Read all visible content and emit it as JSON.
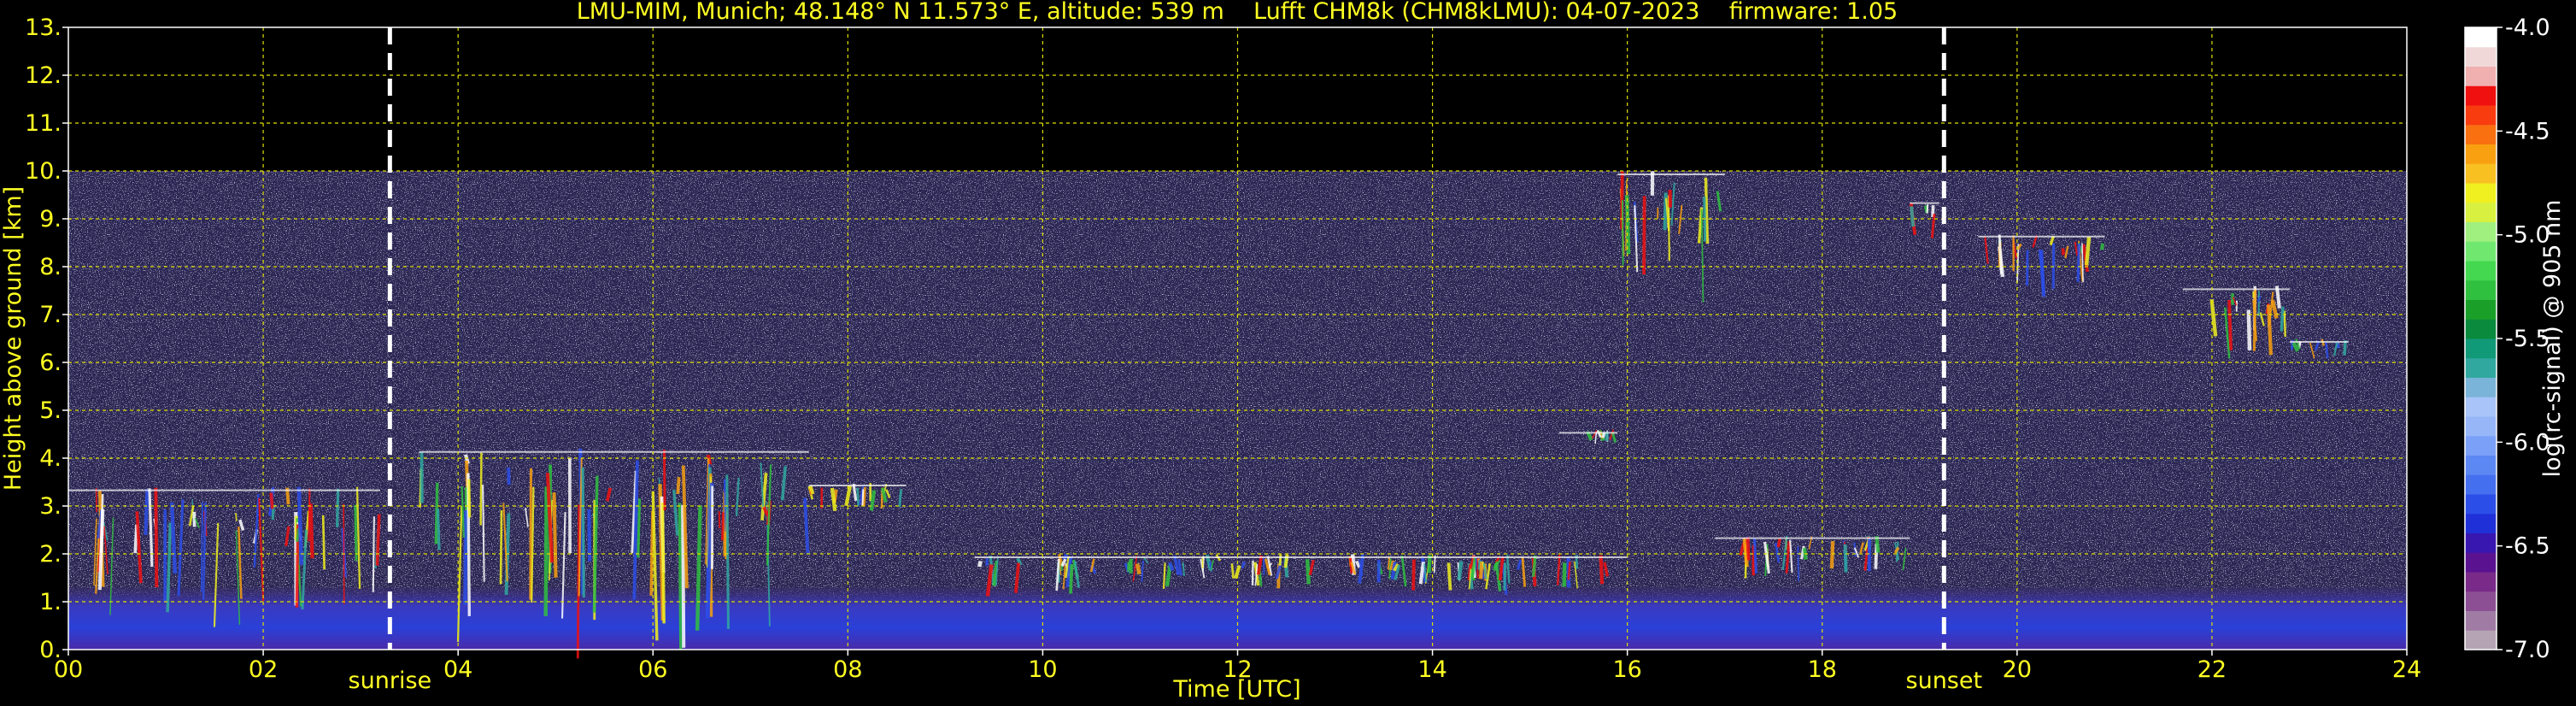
{
  "chart_data": {
    "type": "heatmap",
    "title": "LMU-MIM, Munich; 48.148° N 11.573° E, altitude: 539 m    Lufft CHM8k (CHM8kLMU): 04-07-2023    firmware: 1.05",
    "xlabel": "Time [UTC]",
    "ylabel": "Height above ground [km]",
    "xlim": [
      0,
      24
    ],
    "ylim": [
      0,
      13
    ],
    "x_ticks": [
      "00",
      "02",
      "04",
      "06",
      "08",
      "10",
      "12",
      "14",
      "16",
      "18",
      "20",
      "22",
      "24"
    ],
    "y_ticks": [
      "0.",
      "1.",
      "2.",
      "3.",
      "4.",
      "5.",
      "6.",
      "7.",
      "8.",
      "9.",
      "10.",
      "11.",
      "12.",
      "13."
    ],
    "grid": true,
    "data_top_km": 10,
    "markers": [
      {
        "label": "sunrise",
        "x": 3.3
      },
      {
        "label": "sunset",
        "x": 19.25
      }
    ],
    "colorbar": {
      "label": "log(rc-signal) @ 905 nm",
      "range": [
        -7.0,
        -4.0
      ],
      "ticks": [
        "-4.0",
        "-4.5",
        "-5.0",
        "-5.5",
        "-6.0",
        "-6.5",
        "-7.0"
      ],
      "colors": [
        "#b4a4b4",
        "#a07ca4",
        "#8c4f94",
        "#7a2a88",
        "#5a1290",
        "#3816b0",
        "#2030d8",
        "#2c4ee8",
        "#4470f0",
        "#5c88f4",
        "#7aa0f8",
        "#96b6f8",
        "#a8c4f8",
        "#7ab4d8",
        "#30a8a0",
        "#109a78",
        "#0a8a3c",
        "#1aa028",
        "#30c040",
        "#44d850",
        "#70e870",
        "#a0f080",
        "#d8f040",
        "#f0f020",
        "#f8c020",
        "#f8a010",
        "#f87010",
        "#f83c10",
        "#f01010",
        "#f0b0b0",
        "#f0d8d8",
        "#ffffff"
      ]
    },
    "features": [
      {
        "type": "boundary_layer",
        "x": [
          0,
          24
        ],
        "y": [
          0,
          1.3
        ]
      },
      {
        "type": "clouds",
        "x": [
          0,
          3.2
        ],
        "y": [
          0.8,
          3.4
        ]
      },
      {
        "type": "clouds",
        "x": [
          3.6,
          7.6
        ],
        "y": [
          0.3,
          4.2
        ]
      },
      {
        "type": "clouds",
        "x": [
          7.6,
          8.6
        ],
        "y": [
          3.0,
          3.5
        ]
      },
      {
        "type": "clouds",
        "x": [
          9.3,
          16.0
        ],
        "y": [
          1.3,
          2.0
        ]
      },
      {
        "type": "clouds",
        "x": [
          15.3,
          15.9
        ],
        "y": [
          4.4,
          4.6
        ]
      },
      {
        "type": "clouds",
        "x": [
          15.9,
          17.0
        ],
        "y": [
          7.7,
          10.0
        ]
      },
      {
        "type": "clouds",
        "x": [
          16.9,
          18.9
        ],
        "y": [
          1.6,
          2.4
        ]
      },
      {
        "type": "clouds",
        "x": [
          18.9,
          19.2
        ],
        "y": [
          8.5,
          9.4
        ]
      },
      {
        "type": "clouds",
        "x": [
          19.6,
          20.9
        ],
        "y": [
          7.6,
          8.7
        ]
      },
      {
        "type": "clouds",
        "x": [
          21.7,
          22.8
        ],
        "y": [
          6.0,
          7.6
        ]
      },
      {
        "type": "clouds",
        "x": [
          22.8,
          23.4
        ],
        "y": [
          6.2,
          6.5
        ]
      }
    ]
  }
}
